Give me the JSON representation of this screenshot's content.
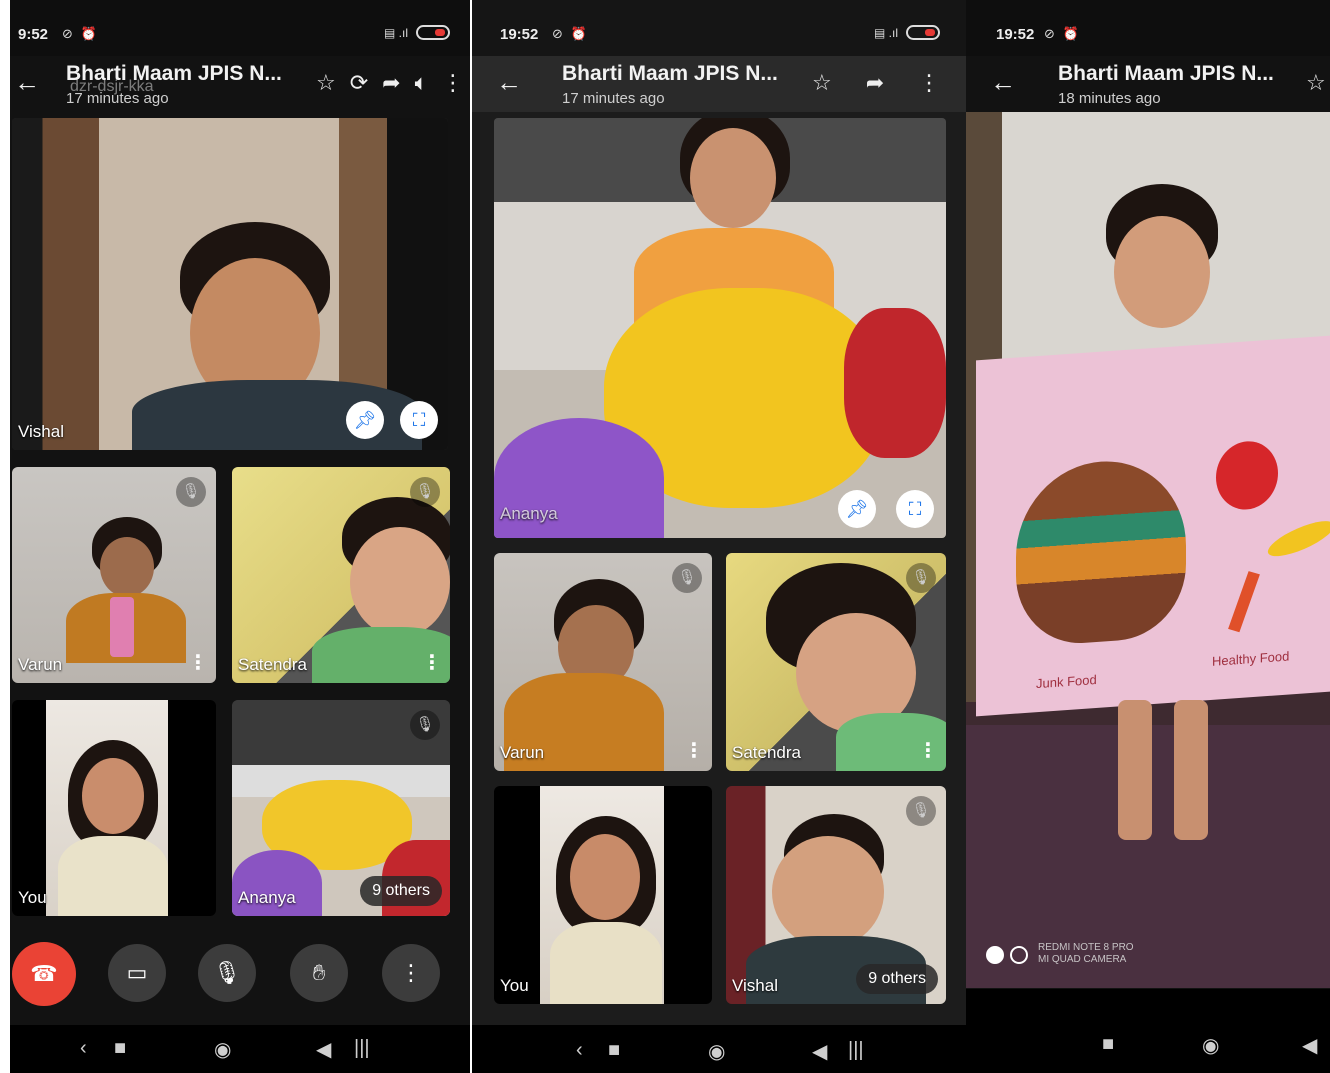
{
  "screens": [
    {
      "status_time": "9:52",
      "title": "Bharti Maam JPIS N...",
      "subtitle": "17 minutes ago",
      "overlay_code": "dzr-dsjr-kka",
      "main_tile": {
        "name": "Vishal"
      },
      "tiles": [
        {
          "name": "Varun"
        },
        {
          "name": "Satendra"
        },
        {
          "name": "You"
        },
        {
          "name": "Ananya",
          "others": "9 others"
        }
      ]
    },
    {
      "status_time": "19:52",
      "title": "Bharti Maam JPIS N...",
      "subtitle": "17 minutes ago",
      "main_tile": {
        "name": "Ananya"
      },
      "tiles": [
        {
          "name": "Varun"
        },
        {
          "name": "Satendra"
        },
        {
          "name": "You"
        },
        {
          "name": "Vishal",
          "others": "9 others"
        }
      ]
    },
    {
      "status_time": "19:52",
      "title": "Bharti Maam JPIS N...",
      "subtitle": "18 minutes ago",
      "watermark_line1": "REDMI NOTE 8 PRO",
      "watermark_line2": "MI QUAD CAMERA",
      "kite_text_left": "Junk Food",
      "kite_text_right": "Healthy Food"
    }
  ],
  "icons": {
    "back": "arrow-left-icon",
    "star": "star-icon",
    "share": "share-icon",
    "more": "more-vert-icon",
    "switch_camera": "switch-camera-icon",
    "speaker": "speaker-icon",
    "pin": "pin-icon",
    "fullscreen": "fullscreen-icon",
    "mic_off": "mic-off-icon",
    "end_call": "end-call-icon",
    "camera": "video-camera-icon",
    "mic": "mic-icon",
    "raise_hand": "raise-hand-icon"
  },
  "colors": {
    "end_call": "#ea4335",
    "pin_accent": "#1a73e8",
    "app_background": "#121212"
  }
}
